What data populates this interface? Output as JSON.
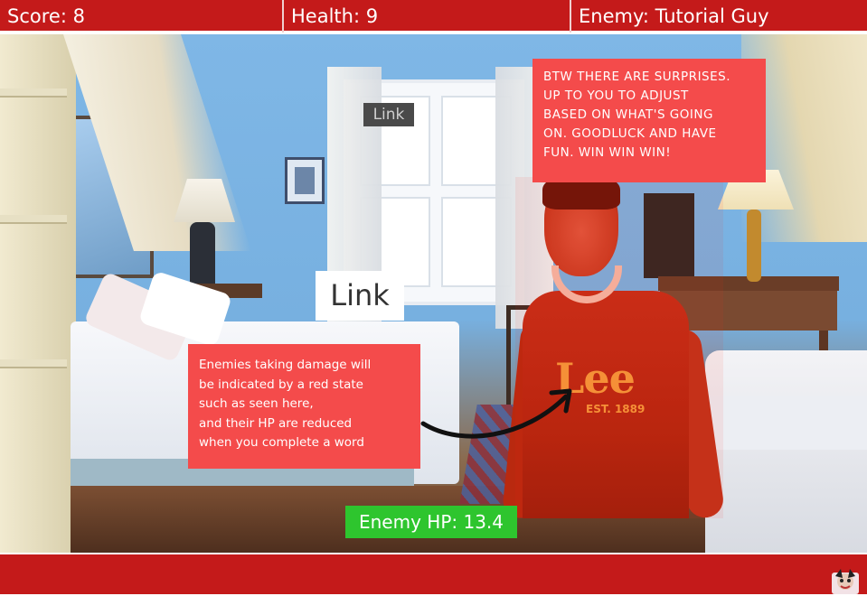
{
  "hud": {
    "score_label": "Score: 8",
    "health_label": "Health: 9",
    "enemy_label": "Enemy: Tutorial Guy"
  },
  "words": {
    "small": "Link",
    "large": "Link"
  },
  "tips": {
    "top_lines": [
      "BTW THERE ARE SURPRISES.",
      "UP TO YOU TO ADJUST",
      "BASED ON WHAT'S GOING",
      "ON. GOODLUCK AND HAVE",
      "FUN. WIN WIN WIN!"
    ],
    "bottom_lines": [
      "Enemies taking damage will",
      "be indicated by a red state",
      "such as seen here,",
      "and their HP are reduced",
      "when you complete a word"
    ]
  },
  "enemy": {
    "hp_label": "Enemy HP: 13.4",
    "shirt_brand": "Lee",
    "shirt_sub": "EST. 1889",
    "state": "damaged"
  },
  "colors": {
    "hud_red": "#c41a1a",
    "tip_red": "#f44b4b",
    "hp_green": "#2ec52e"
  },
  "icons": {
    "mascot": "mascot-icon",
    "arrow": "pointer-arrow-icon"
  }
}
